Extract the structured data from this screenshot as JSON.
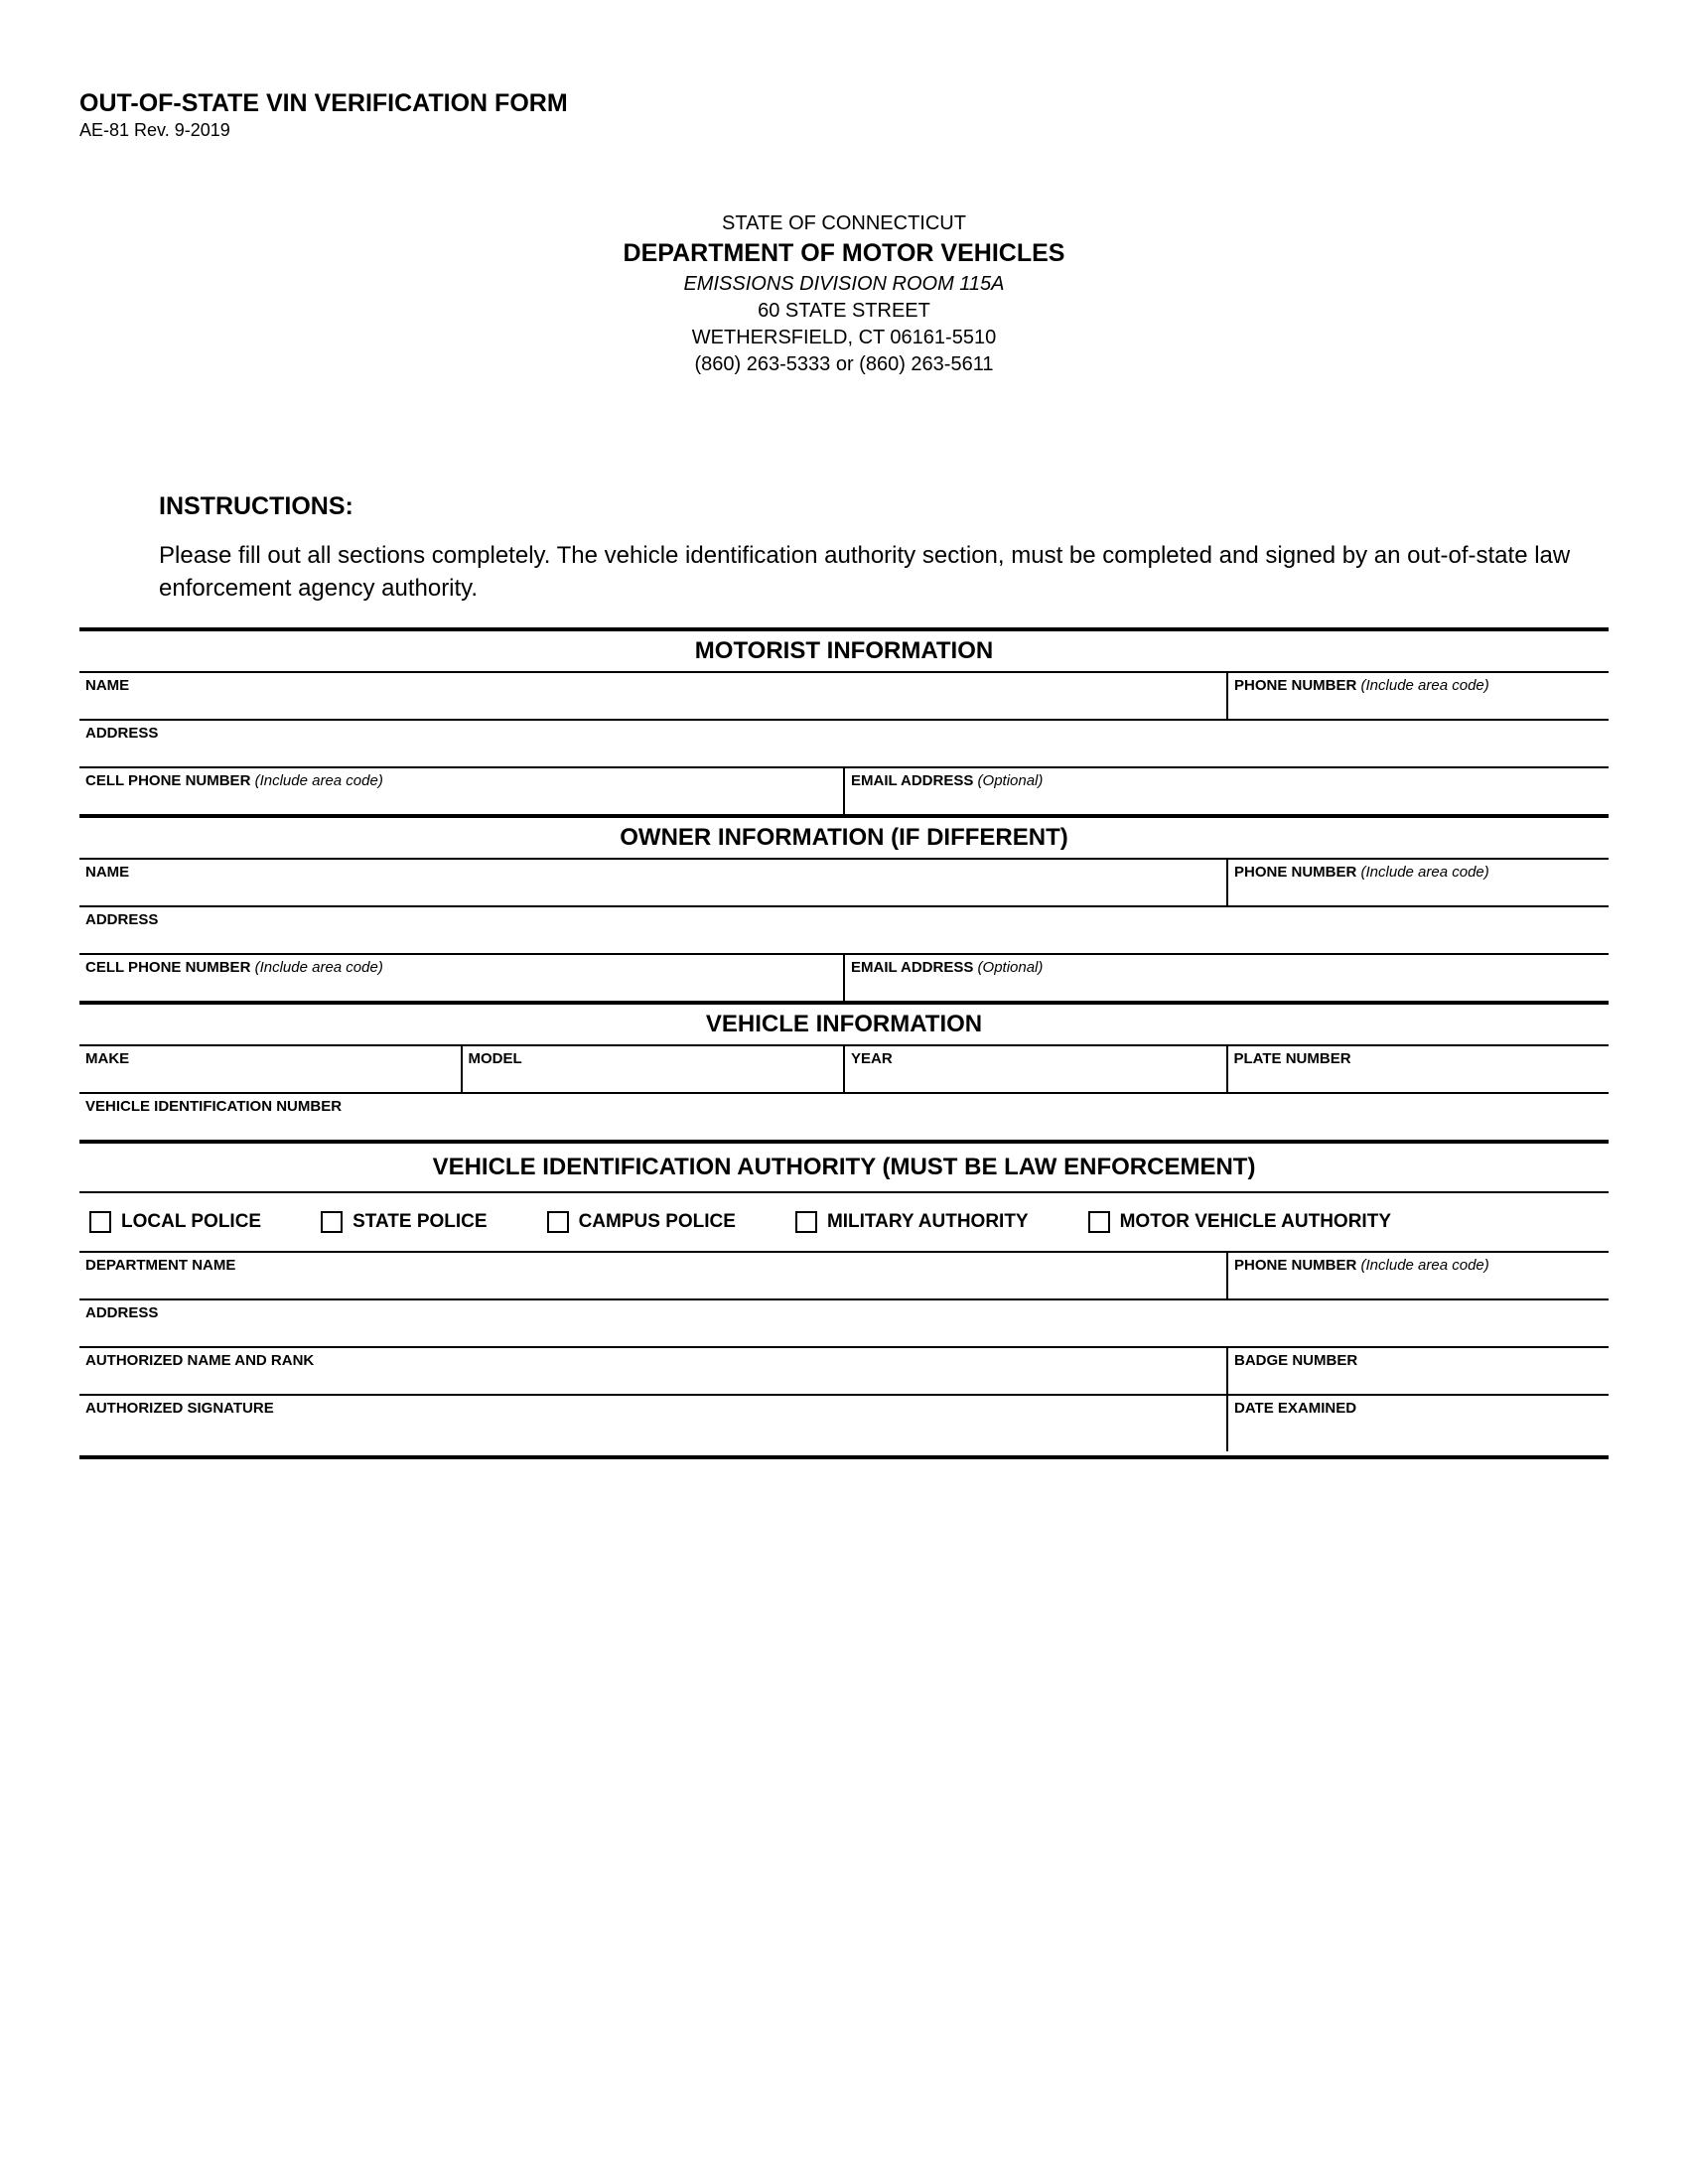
{
  "header": {
    "title": "OUT-OF-STATE VIN VERIFICATION FORM",
    "revision": "AE-81 Rev. 9-2019"
  },
  "agency": {
    "state": "STATE OF CONNECTICUT",
    "dept": "DEPARTMENT OF MOTOR VEHICLES",
    "division": "EMISSIONS DIVISION ROOM 115A",
    "street": "60 STATE STREET",
    "city": "WETHERSFIELD, CT 06161-5510",
    "phones": "(860) 263-5333 or (860) 263-5611"
  },
  "instructions": {
    "heading": "INSTRUCTIONS:",
    "text": "Please fill out all sections completely.  The vehicle identification authority section, must be completed and signed by an out-of-state law enforcement agency authority."
  },
  "sections": {
    "motorist": {
      "title": "MOTORIST INFORMATION",
      "name": "NAME",
      "phone": "PHONE NUMBER",
      "phone_hint": " (Include area code)",
      "address": "ADDRESS",
      "cell": "CELL PHONE NUMBER",
      "cell_hint": " (Include area code)",
      "email": "EMAIL ADDRESS",
      "email_hint": " (Optional)"
    },
    "owner": {
      "title": "OWNER INFORMATION (IF DIFFERENT)",
      "name": "NAME",
      "phone": "PHONE NUMBER",
      "phone_hint": " (Include area code)",
      "address": "ADDRESS",
      "cell": "CELL PHONE NUMBER",
      "cell_hint": " (Include area code)",
      "email": "EMAIL ADDRESS",
      "email_hint": " (Optional)"
    },
    "vehicle": {
      "title": "VEHICLE INFORMATION",
      "make": "MAKE",
      "model": "MODEL",
      "year": "YEAR",
      "plate": "PLATE NUMBER",
      "vin": "VEHICLE IDENTIFICATION NUMBER"
    },
    "authority": {
      "title": "VEHICLE IDENTIFICATION AUTHORITY (MUST BE LAW ENFORCEMENT)",
      "options": {
        "local": "LOCAL POLICE",
        "state": "STATE POLICE",
        "campus": "CAMPUS POLICE",
        "military": "MILITARY AUTHORITY",
        "motor": "MOTOR VEHICLE AUTHORITY"
      },
      "dept_name": "DEPARTMENT NAME",
      "phone": "PHONE NUMBER",
      "phone_hint": " (Include area code)",
      "address": "ADDRESS",
      "auth_name": "AUTHORIZED NAME AND RANK",
      "badge": "BADGE NUMBER",
      "signature": "AUTHORIZED SIGNATURE",
      "date": "DATE EXAMINED"
    }
  }
}
